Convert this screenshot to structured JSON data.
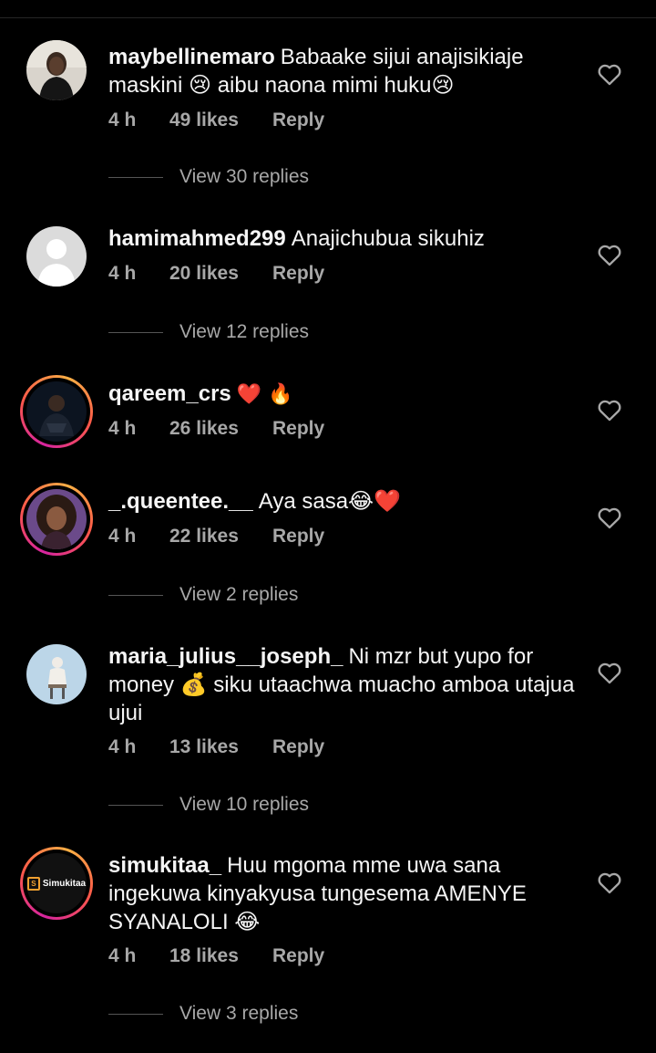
{
  "comments": [
    {
      "username": "maybellinemaro",
      "text": "Babaake sijui anajisikiaje maskini 😢 aibu naona mimi huku😢",
      "time": "4 h",
      "likes": "49 likes",
      "reply": "Reply",
      "view_replies": "View 30 replies",
      "avatar_icon": "profile-photo-woman-icon"
    },
    {
      "username": "hamimahmed299",
      "text": "Anajichubua sikuhiz",
      "time": "4 h",
      "likes": "20 likes",
      "reply": "Reply",
      "view_replies": "View 12 replies",
      "avatar_icon": "default-avatar-icon"
    },
    {
      "username": "qareem_crs",
      "text": "❤️ 🔥",
      "time": "4 h",
      "likes": "26 likes",
      "reply": "Reply",
      "view_replies": "",
      "avatar_icon": "profile-photo-man-icon"
    },
    {
      "username": "_.queentee.__",
      "text": "Aya sasa😂❤️",
      "time": "4 h",
      "likes": "22 likes",
      "reply": "Reply",
      "view_replies": "View 2 replies",
      "avatar_icon": "profile-photo-woman-icon"
    },
    {
      "username": "maria_julius__joseph_",
      "text": "Ni mzr but yupo for money 💰 siku utaachwa muacho amboa utajua ujui",
      "time": "4 h",
      "likes": "13 likes",
      "reply": "Reply",
      "view_replies": "View 10 replies",
      "avatar_icon": "profile-photo-figure-icon"
    },
    {
      "username": "simukitaa_",
      "text": "Huu mgoma mme uwa sana ingekuwa kinyakyusa tungesema AMENYE SYANALOLI 😂",
      "time": "4 h",
      "likes": "18 likes",
      "reply": "Reply",
      "view_replies": "View 3 replies",
      "avatar_icon": "simukitaa-logo-icon",
      "avatar_logo_text": "Simukitaa"
    }
  ],
  "colors": {
    "background": "#000000",
    "text": "#f5f5f5",
    "secondary_text": "#a8a8a8",
    "heart": "#a8a8a8"
  }
}
